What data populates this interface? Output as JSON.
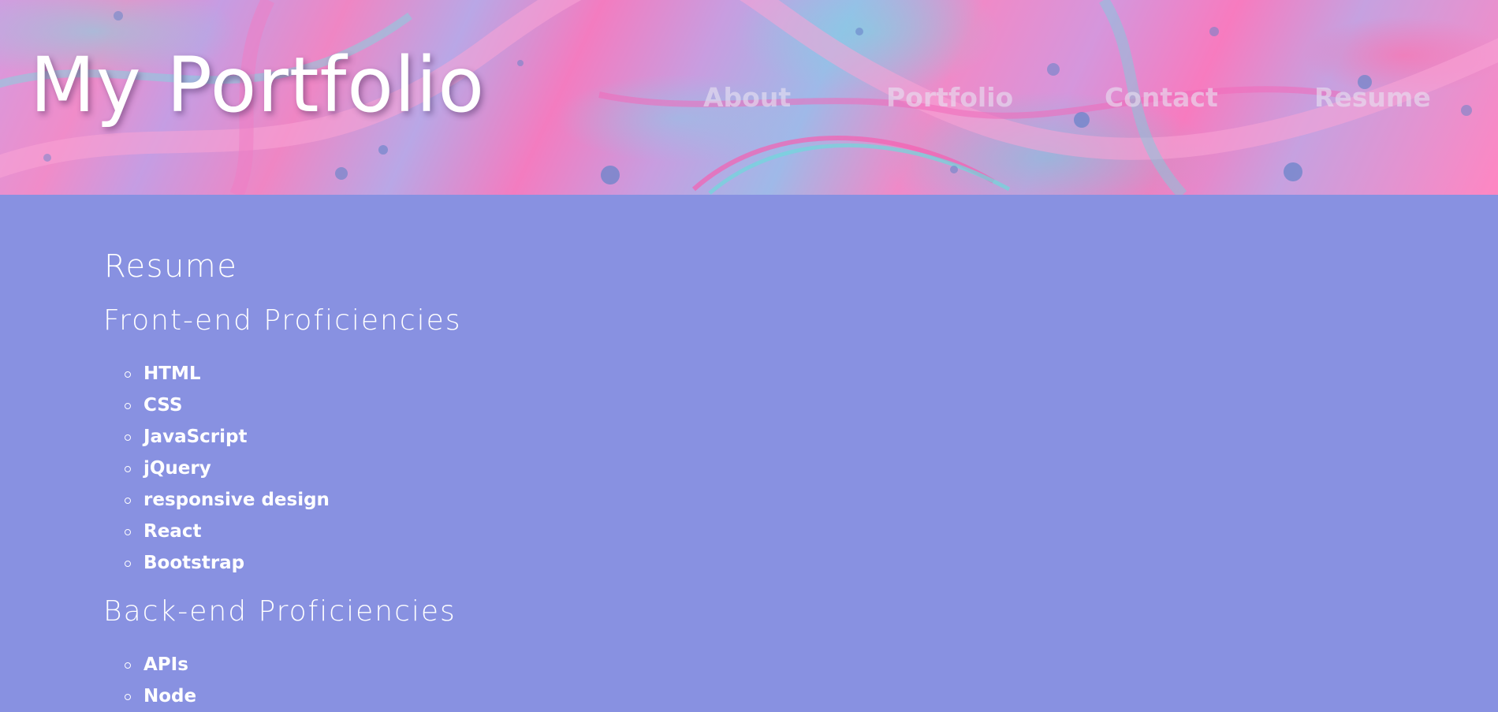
{
  "header": {
    "site_title": "My Portfolio",
    "nav": [
      {
        "label": "About"
      },
      {
        "label": "Portfolio"
      },
      {
        "label": "Contact"
      },
      {
        "label": "Resume"
      }
    ]
  },
  "main": {
    "page_title": "Resume",
    "front_end": {
      "heading": "Front-end Proficiencies",
      "skills": [
        "HTML",
        "CSS",
        "JavaScript",
        "jQuery",
        "responsive design",
        "React",
        "Bootstrap"
      ]
    },
    "back_end": {
      "heading": "Back-end Proficiencies",
      "skills": [
        "APIs",
        "Node"
      ]
    }
  },
  "colors": {
    "page_background": "#8891e1",
    "text": "#ffffff",
    "nav_link": "rgba(230,225,240,0.62)",
    "header_pink": "#f08cc9",
    "header_teal": "#78dce1"
  },
  "icons": {
    "list_bullet": "hollow-circle-icon"
  }
}
